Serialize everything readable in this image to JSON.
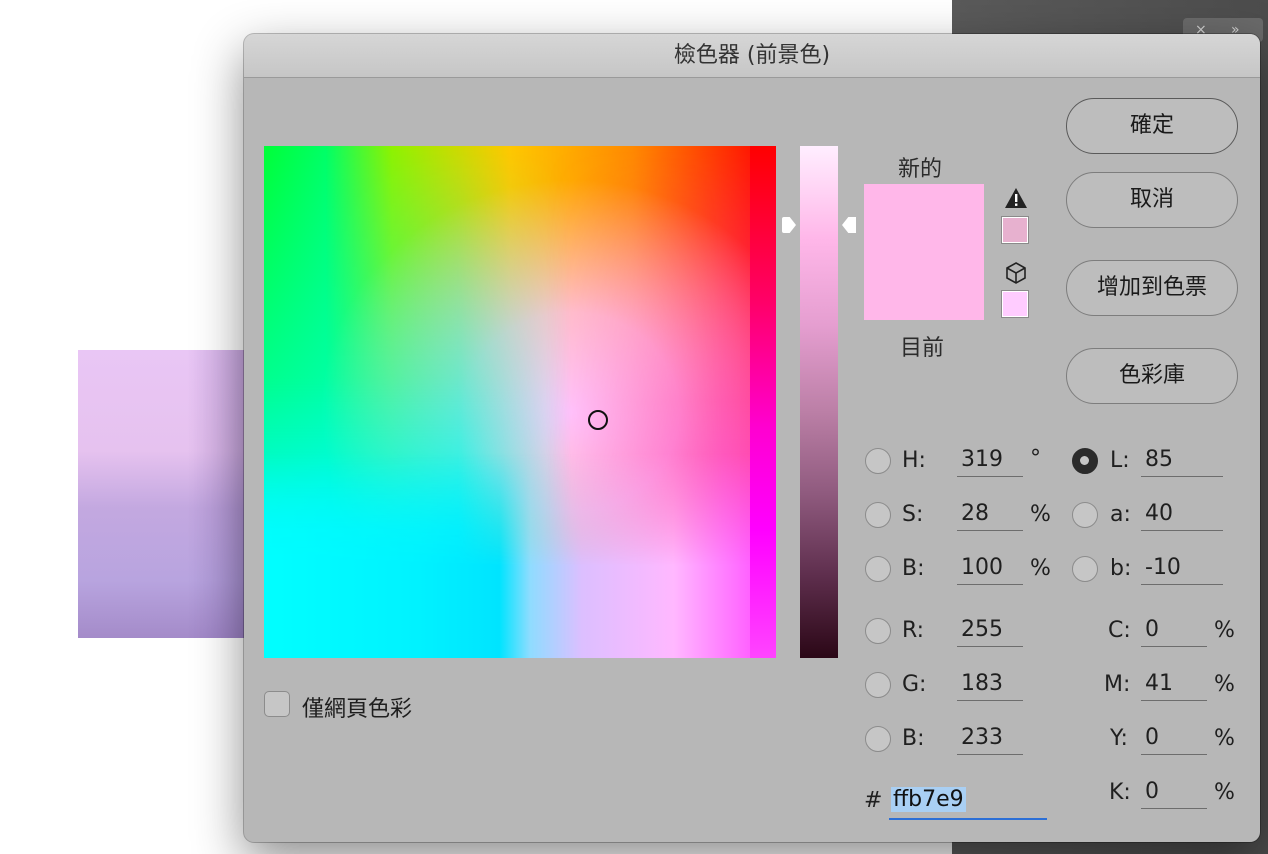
{
  "dialog": {
    "title": "檢色器 (前景色)"
  },
  "colors": {
    "current_hex": "#ffb7e9",
    "gamut_warning_swatch": "#e7b1cf",
    "web_safe_swatch": "#ffccff"
  },
  "preview": {
    "new_label": "新的",
    "current_label": "目前"
  },
  "buttons": {
    "ok": "確定",
    "cancel": "取消",
    "add_to_swatches": "增加到色票",
    "color_libraries": "色彩庫"
  },
  "hsb": {
    "h": {
      "label": "H:",
      "value": "319",
      "unit": "°"
    },
    "s": {
      "label": "S:",
      "value": "28",
      "unit": "%"
    },
    "b": {
      "label": "B:",
      "value": "100",
      "unit": "%"
    }
  },
  "rgb": {
    "r": {
      "label": "R:",
      "value": "255"
    },
    "g": {
      "label": "G:",
      "value": "183"
    },
    "b": {
      "label": "B:",
      "value": "233"
    }
  },
  "lab": {
    "l": {
      "label": "L:",
      "value": "85"
    },
    "a": {
      "label": "a:",
      "value": "40"
    },
    "b": {
      "label": "b:",
      "value": "-10"
    }
  },
  "cmyk": {
    "c": {
      "label": "C:",
      "value": "0",
      "unit": "%"
    },
    "m": {
      "label": "M:",
      "value": "41",
      "unit": "%"
    },
    "y": {
      "label": "Y:",
      "value": "0",
      "unit": "%"
    },
    "k": {
      "label": "K:",
      "value": "0",
      "unit": "%"
    }
  },
  "hex": {
    "hash": "#",
    "value": "ffb7e9"
  },
  "web_only": {
    "label": "僅網頁色彩"
  },
  "bg_panel": {
    "close_glyph": "×",
    "collapse_glyph": "»"
  }
}
